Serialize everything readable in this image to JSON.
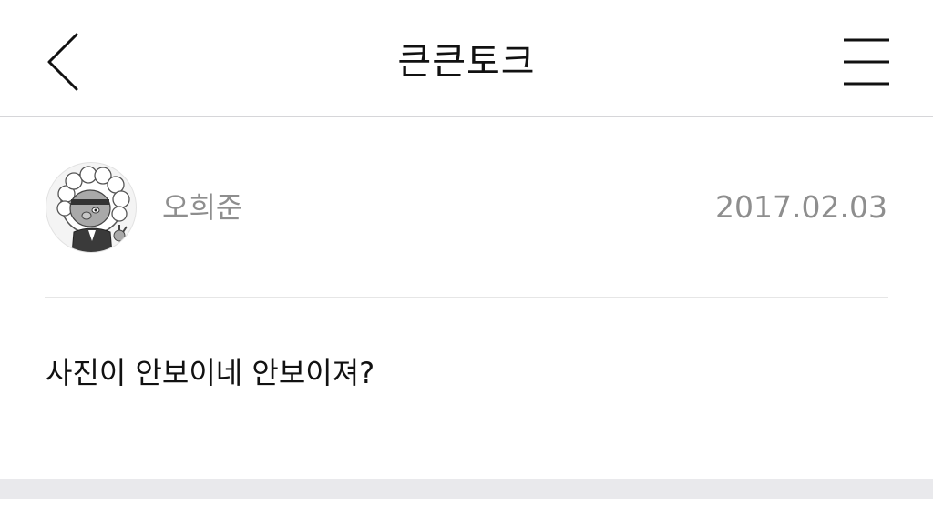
{
  "header": {
    "title": "큰큰토크",
    "back_icon": "chevron-left-icon",
    "menu_icon": "hamburger-menu-icon"
  },
  "post": {
    "author": "오희준",
    "date": "2017.02.03",
    "avatar_icon": "character-avatar-icon",
    "content": "사진이 안보이네 안보이져?"
  },
  "colors": {
    "text_primary": "#111111",
    "text_secondary": "#8e8e8e",
    "divider": "#e6e6e6",
    "band": "#e9e9ec"
  }
}
